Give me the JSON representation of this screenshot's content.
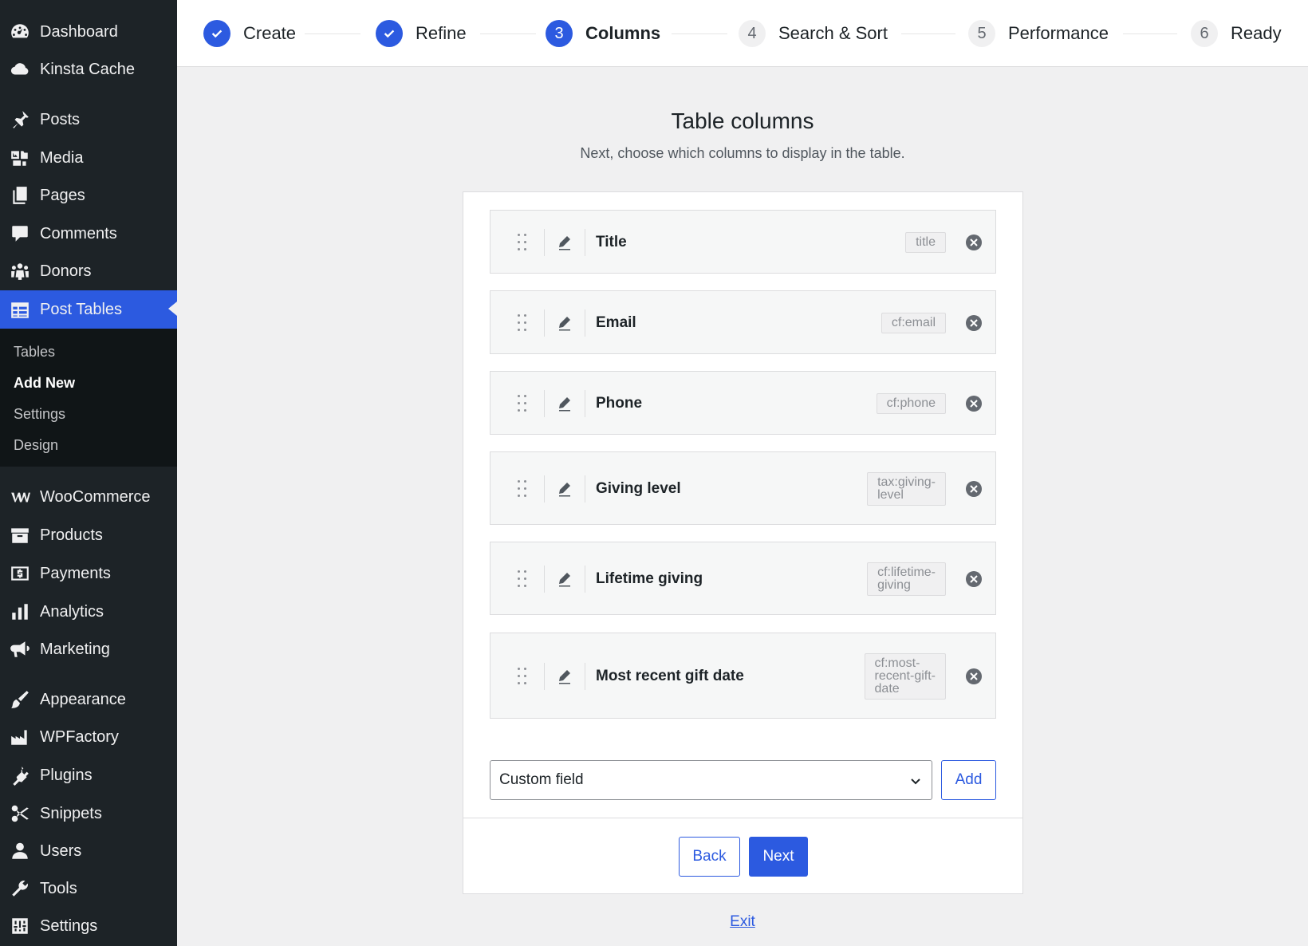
{
  "sidebar": {
    "items": [
      {
        "label": "Dashboard",
        "icon": "dashboard-icon"
      },
      {
        "label": "Kinsta Cache",
        "icon": "cloud-icon"
      },
      {
        "label": "Posts",
        "icon": "pin-icon"
      },
      {
        "label": "Media",
        "icon": "media-icon"
      },
      {
        "label": "Pages",
        "icon": "pages-icon"
      },
      {
        "label": "Comments",
        "icon": "comment-icon"
      },
      {
        "label": "Donors",
        "icon": "groups-icon"
      },
      {
        "label": "Post Tables",
        "icon": "table-icon",
        "active": true
      },
      {
        "label": "WooCommerce",
        "icon": "woo-icon"
      },
      {
        "label": "Products",
        "icon": "archive-icon"
      },
      {
        "label": "Payments",
        "icon": "money-icon"
      },
      {
        "label": "Analytics",
        "icon": "bar-chart-icon"
      },
      {
        "label": "Marketing",
        "icon": "megaphone-icon"
      },
      {
        "label": "Appearance",
        "icon": "brush-icon"
      },
      {
        "label": "WPFactory",
        "icon": "factory-icon"
      },
      {
        "label": "Plugins",
        "icon": "plug-icon"
      },
      {
        "label": "Snippets",
        "icon": "scissors-icon"
      },
      {
        "label": "Users",
        "icon": "user-icon"
      },
      {
        "label": "Tools",
        "icon": "wrench-icon"
      },
      {
        "label": "Settings",
        "icon": "settings-icon"
      }
    ],
    "submenu": [
      {
        "label": "Tables"
      },
      {
        "label": "Add New",
        "current": true
      },
      {
        "label": "Settings"
      },
      {
        "label": "Design"
      }
    ]
  },
  "stepper": {
    "steps": [
      {
        "label": "Create",
        "state": "done",
        "number": "1"
      },
      {
        "label": "Refine",
        "state": "done",
        "number": "2"
      },
      {
        "label": "Columns",
        "state": "current",
        "number": "3"
      },
      {
        "label": "Search & Sort",
        "state": "todo",
        "number": "4"
      },
      {
        "label": "Performance",
        "state": "todo",
        "number": "5"
      },
      {
        "label": "Ready",
        "state": "todo",
        "number": "6"
      }
    ]
  },
  "main": {
    "title": "Table columns",
    "subtitle": "Next, choose which columns to display in the table.",
    "columns": [
      {
        "name": "Title",
        "key": "title"
      },
      {
        "name": "Email",
        "key": "cf:email"
      },
      {
        "name": "Phone",
        "key": "cf:phone"
      },
      {
        "name": "Giving level",
        "key": "tax:giving-\nlevel"
      },
      {
        "name": "Lifetime giving",
        "key": "cf:lifetime-\ngiving"
      },
      {
        "name": "Most recent gift date",
        "key": "cf:most-\nrecent-gift-\ndate"
      }
    ],
    "column_type_select": "Custom field",
    "add_label": "Add",
    "back_label": "Back",
    "next_label": "Next",
    "exit_label": "Exit"
  },
  "colors": {
    "accent": "#2c5ae0",
    "sidebar_bg": "#1d2327",
    "submenu_bg": "#101517"
  }
}
